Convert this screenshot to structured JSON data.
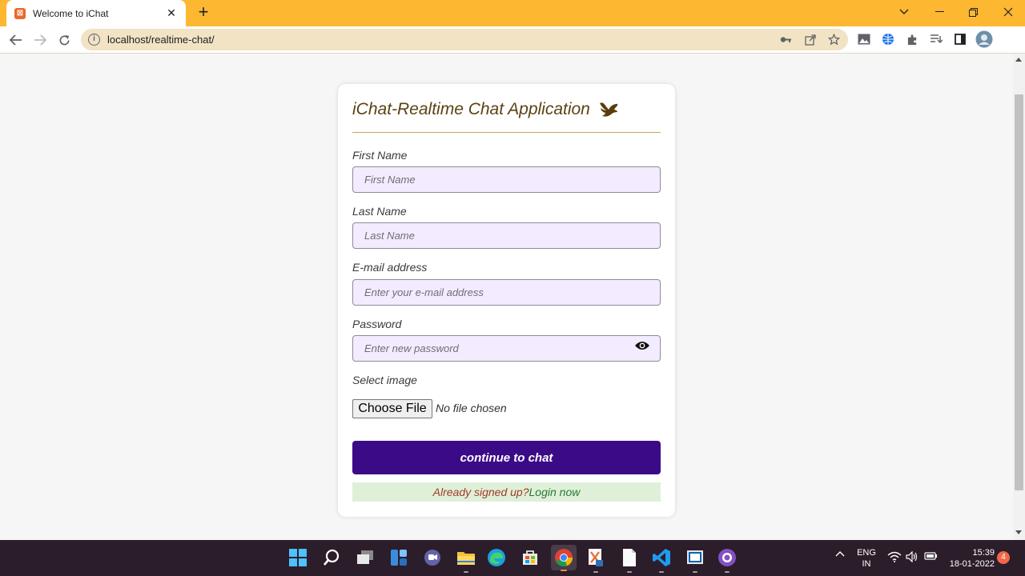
{
  "browser": {
    "tab_title": "Welcome to iChat",
    "tab_favicon": "xampp-icon",
    "url": "localhost/realtime-chat/",
    "accent_color": "#fdb731"
  },
  "form": {
    "title": "iChat-Realtime Chat Application",
    "title_icon": "dove-icon",
    "first_name": {
      "label": "First Name",
      "placeholder": "First Name",
      "value": ""
    },
    "last_name": {
      "label": "Last Name",
      "placeholder": "Last Name",
      "value": ""
    },
    "email": {
      "label": "E-mail address",
      "placeholder": "Enter your e-mail address",
      "value": ""
    },
    "password": {
      "label": "Password",
      "placeholder": "Enter new password",
      "value": ""
    },
    "image": {
      "label": "Select image",
      "button_label": "Choose File",
      "status": "No file chosen"
    },
    "submit_label": "continue to chat",
    "signed_up_text": "Already signed up?",
    "login_link": "Login now",
    "button_color": "#3b0b87"
  },
  "taskbar": {
    "language_line1": "ENG",
    "language_line2": "IN",
    "time": "15:39",
    "date": "18-01-2022",
    "notification_count": "4",
    "apps": [
      "start-icon",
      "search-icon",
      "task-view-icon",
      "widgets-icon",
      "teams-chat-icon",
      "file-explorer-icon",
      "edge-icon",
      "store-icon",
      "chrome-icon",
      "xampp-control-icon",
      "notepad-icon",
      "vscode-icon",
      "app-icon",
      "github-desktop-icon"
    ]
  }
}
